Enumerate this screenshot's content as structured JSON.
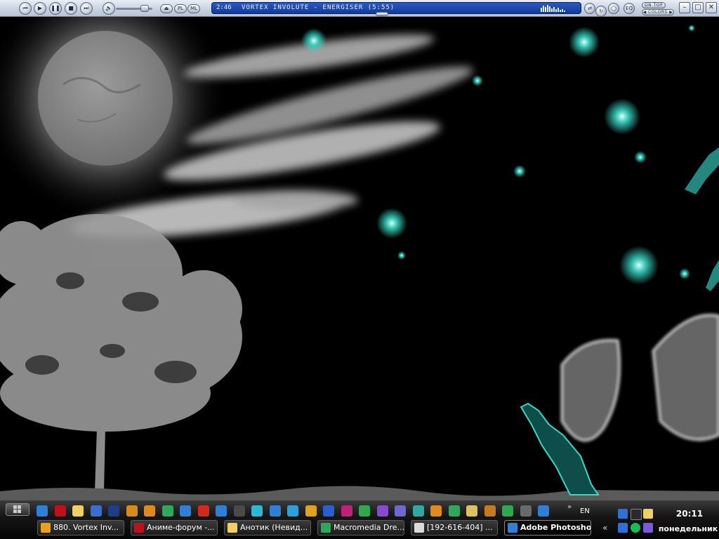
{
  "player": {
    "time": "2:46",
    "track_title": "VORTEX INVOLUTE - ENERGISER (5:55)",
    "pl_label": "PL",
    "ml_label": "ML",
    "eq_label": "EQ",
    "on_top_label": "ON TOP",
    "colors_label": "COLORS",
    "seek_progress": 0.46
  },
  "taskbar": {
    "quick_icons": [
      "ie-icon",
      "opera-icon",
      "app-icon",
      "doc-icon",
      "save-icon",
      "game-icon",
      "mail-icon",
      "browser-icon",
      "media-icon",
      "flash-icon",
      "photoshop-icon",
      "terminal-icon",
      "cd-icon",
      "lightning-icon",
      "globe-icon",
      "image-icon",
      "word-icon",
      "reader-icon",
      "excel-icon",
      "purple-icon",
      "settings-icon",
      "graph-icon",
      "fireworks-icon",
      "dreamweaver-icon",
      "folder-icon",
      "paint-icon",
      "brush-icon",
      "notepad-icon",
      "calc-icon"
    ],
    "lang": "EN",
    "tasks": [
      {
        "label": "880. Vortex Inv...",
        "active": false,
        "color": "#e9a21a"
      },
      {
        "label": "Аниме-форум -...",
        "active": false,
        "color": "#c0101a"
      },
      {
        "label": "Анотик (Невид...",
        "active": false,
        "color": "#f0d060"
      },
      {
        "label": "Macromedia Dre...",
        "active": false,
        "color": "#2ba85a"
      },
      {
        "label": "[192-616-404] ...",
        "active": false,
        "color": "#d9d9d9"
      },
      {
        "label": "Adobe Photoshop",
        "active": true,
        "color": "#2f7fd6"
      }
    ],
    "clock": "20:11",
    "day": "понедельник"
  },
  "colors": {
    "display_bg": "#1c4ab0",
    "taskbar_bg": "#1a1a1a",
    "star": "#3ad6c4"
  }
}
